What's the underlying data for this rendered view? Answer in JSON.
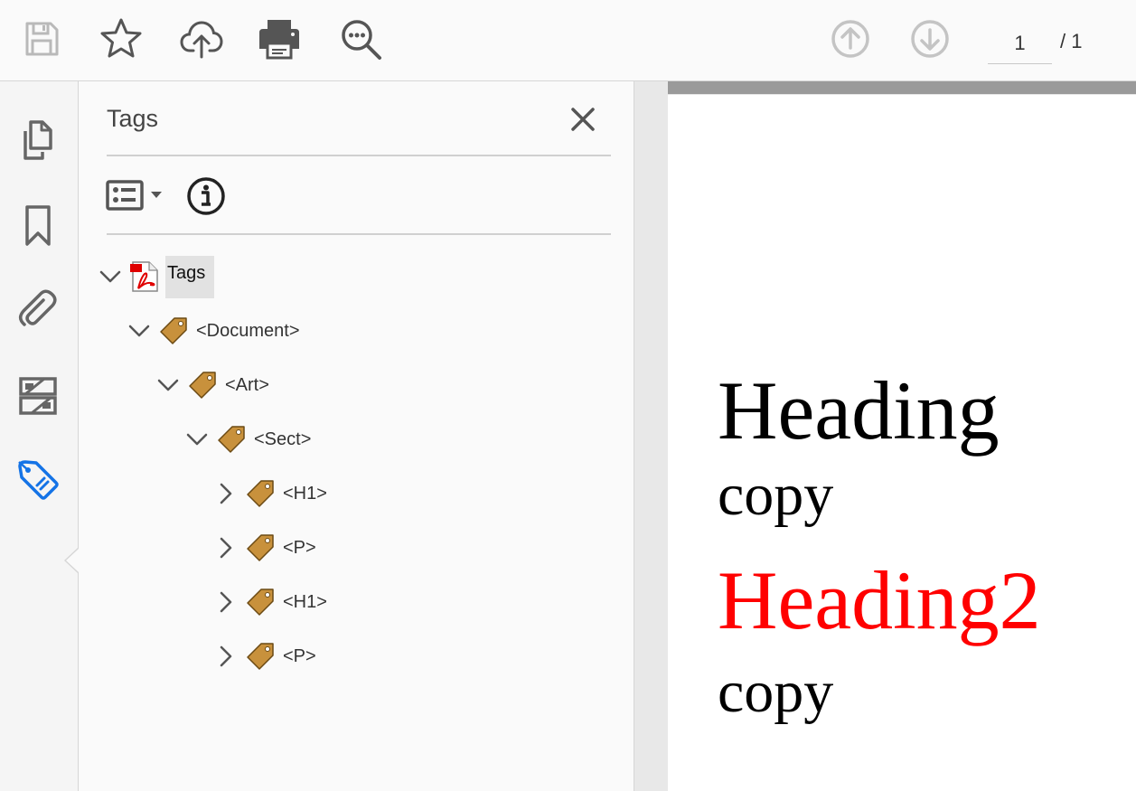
{
  "toolbar": {
    "icons": [
      "save-icon",
      "bookmark-star-icon",
      "upload-cloud-icon",
      "print-icon",
      "search-zoom-icon",
      "previous-page-icon",
      "next-page-icon"
    ],
    "current_page": "1",
    "page_total": "/ 1"
  },
  "rail": {
    "icons": [
      "pages-icon",
      "bookmark-icon",
      "attachment-icon",
      "layers-icon",
      "tags-icon"
    ],
    "active_icon": "tags-icon",
    "active_color": "#1473e6"
  },
  "panel": {
    "title": "Tags",
    "tree": [
      {
        "label": "Tags",
        "level": 0,
        "expanded": true,
        "icon": "pdf-file-icon"
      },
      {
        "label": "<Document>",
        "level": 1,
        "expanded": true,
        "icon": "tag-icon"
      },
      {
        "label": "<Art>",
        "level": 2,
        "expanded": true,
        "icon": "tag-icon"
      },
      {
        "label": "<Sect>",
        "level": 3,
        "expanded": true,
        "icon": "tag-icon"
      },
      {
        "label": "<H1>",
        "level": 4,
        "expanded": false,
        "icon": "tag-icon"
      },
      {
        "label": "<P>",
        "level": 4,
        "expanded": false,
        "icon": "tag-icon"
      },
      {
        "label": "<H1>",
        "level": 4,
        "expanded": false,
        "icon": "tag-icon"
      },
      {
        "label": "<P>",
        "level": 4,
        "expanded": false,
        "icon": "tag-icon"
      }
    ]
  },
  "document": {
    "heading1": "Heading",
    "copy1": "copy",
    "heading2": "Heading2",
    "copy2": "copy",
    "heading2_color": "#ff0000"
  }
}
